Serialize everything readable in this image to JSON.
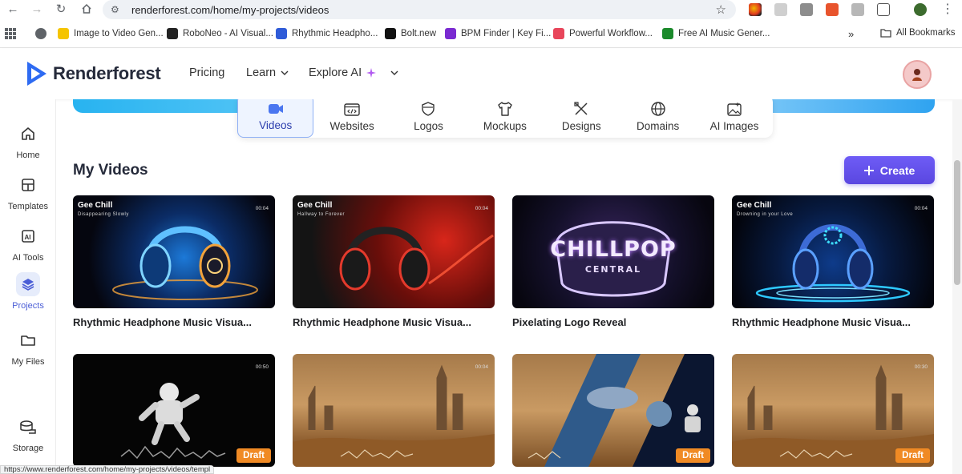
{
  "browser": {
    "url": "renderforest.com/home/my-projects/videos",
    "bookmarks": [
      {
        "label": "Image to Video Gen..."
      },
      {
        "label": "RoboNeo - AI Visual..."
      },
      {
        "label": "Rhythmic Headpho..."
      },
      {
        "label": "Bolt.new"
      },
      {
        "label": "BPM Finder | Key Fi..."
      },
      {
        "label": "Powerful Workflow..."
      },
      {
        "label": "Free AI Music Gener..."
      }
    ],
    "more_label": "»",
    "all_bookmarks": "All Bookmarks",
    "status_url": "https://www.renderforest.com/home/my-projects/videos/templ"
  },
  "header": {
    "brand": "Renderforest",
    "nav": {
      "pricing": "Pricing",
      "learn": "Learn",
      "explore": "Explore AI"
    }
  },
  "sidebar": {
    "items": [
      {
        "label": "Home"
      },
      {
        "label": "Templates"
      },
      {
        "label": "AI Tools"
      },
      {
        "label": "Projects"
      },
      {
        "label": "My Files"
      },
      {
        "label": "Storage"
      }
    ]
  },
  "tabs": [
    {
      "label": "Videos"
    },
    {
      "label": "Websites"
    },
    {
      "label": "Logos"
    },
    {
      "label": "Mockups"
    },
    {
      "label": "Designs"
    },
    {
      "label": "Domains"
    },
    {
      "label": "AI Images"
    }
  ],
  "main": {
    "title": "My Videos",
    "create_label": "Create"
  },
  "videos": [
    {
      "title": "Rhythmic Headphone Music Visua...",
      "brand": "Gee Chill",
      "subtitle": "Disappearing Slowly",
      "duration": "00:04"
    },
    {
      "title": "Rhythmic Headphone Music Visua...",
      "brand": "Gee Chill",
      "subtitle": "Hallway to Forever",
      "duration": "00:04"
    },
    {
      "title": "Pixelating Logo Reveal",
      "logo_top": "CHILLPOP",
      "logo_bottom": "CENTRAL"
    },
    {
      "title": "Rhythmic Headphone Music Visua...",
      "brand": "Gee Chill",
      "subtitle": "Drowning in your Love",
      "duration": "00:04"
    },
    {
      "duration": "00:50",
      "draft": "Draft"
    },
    {
      "duration": "00:04"
    },
    {
      "draft": "Draft"
    },
    {
      "duration": "00:30",
      "draft": "Draft"
    }
  ]
}
